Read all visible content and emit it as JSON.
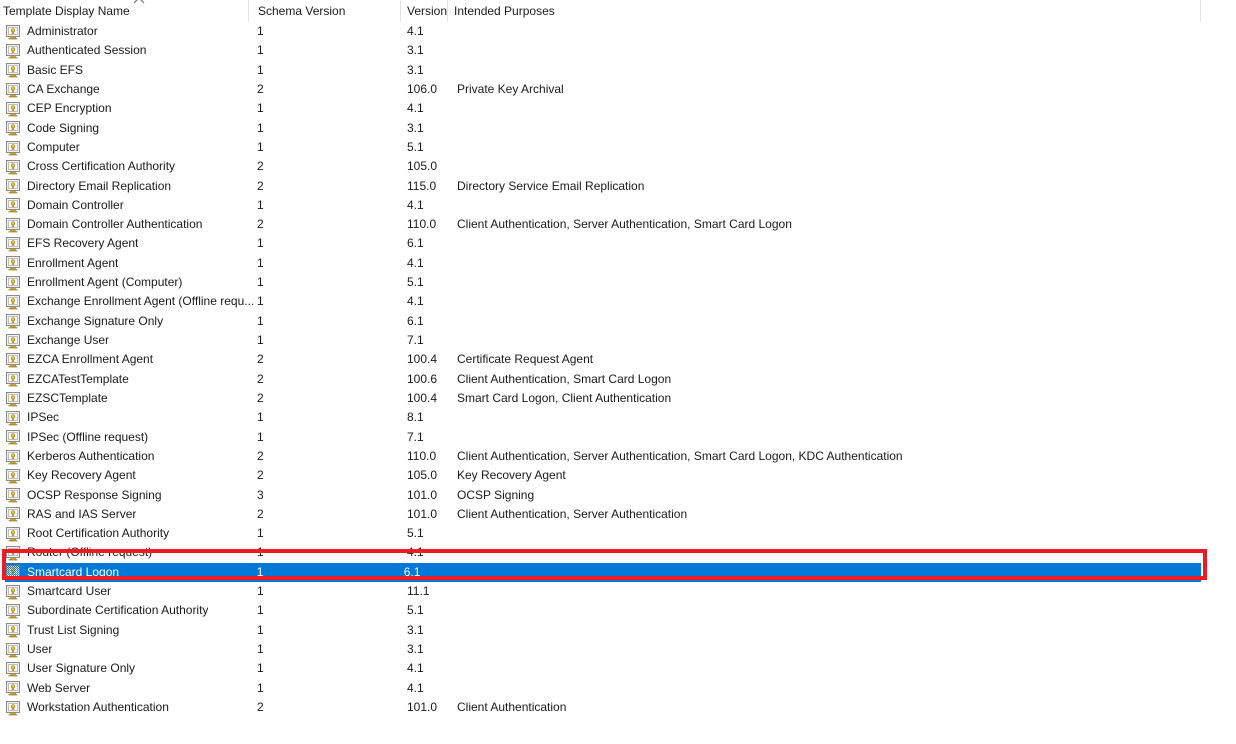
{
  "list": {
    "columns": [
      {
        "key": "name",
        "label": "Template Display Name",
        "sort": "ascending"
      },
      {
        "key": "schema",
        "label": "Schema Version"
      },
      {
        "key": "version",
        "label": "Version"
      },
      {
        "key": "purpose",
        "label": "Intended Purposes"
      }
    ],
    "icon": "certificate-template-icon",
    "selection_color": "#0078d7",
    "annotation_color": "#ed1c24",
    "selected_row_index": 28,
    "rows": [
      {
        "name": "Administrator",
        "schema": "1",
        "version": "4.1",
        "purpose": ""
      },
      {
        "name": "Authenticated Session",
        "schema": "1",
        "version": "3.1",
        "purpose": ""
      },
      {
        "name": "Basic EFS",
        "schema": "1",
        "version": "3.1",
        "purpose": ""
      },
      {
        "name": "CA Exchange",
        "schema": "2",
        "version": "106.0",
        "purpose": "Private Key Archival"
      },
      {
        "name": "CEP Encryption",
        "schema": "1",
        "version": "4.1",
        "purpose": ""
      },
      {
        "name": "Code Signing",
        "schema": "1",
        "version": "3.1",
        "purpose": ""
      },
      {
        "name": "Computer",
        "schema": "1",
        "version": "5.1",
        "purpose": ""
      },
      {
        "name": "Cross Certification Authority",
        "schema": "2",
        "version": "105.0",
        "purpose": ""
      },
      {
        "name": "Directory Email Replication",
        "schema": "2",
        "version": "115.0",
        "purpose": "Directory Service Email Replication"
      },
      {
        "name": "Domain Controller",
        "schema": "1",
        "version": "4.1",
        "purpose": ""
      },
      {
        "name": "Domain Controller Authentication",
        "schema": "2",
        "version": "110.0",
        "purpose": "Client Authentication, Server Authentication, Smart Card Logon"
      },
      {
        "name": "EFS Recovery Agent",
        "schema": "1",
        "version": "6.1",
        "purpose": ""
      },
      {
        "name": "Enrollment Agent",
        "schema": "1",
        "version": "4.1",
        "purpose": ""
      },
      {
        "name": "Enrollment Agent (Computer)",
        "schema": "1",
        "version": "5.1",
        "purpose": ""
      },
      {
        "name": "Exchange Enrollment Agent (Offline requ...",
        "schema": "1",
        "version": "4.1",
        "purpose": ""
      },
      {
        "name": "Exchange Signature Only",
        "schema": "1",
        "version": "6.1",
        "purpose": ""
      },
      {
        "name": "Exchange User",
        "schema": "1",
        "version": "7.1",
        "purpose": ""
      },
      {
        "name": "EZCA Enrollment Agent",
        "schema": "2",
        "version": "100.4",
        "purpose": "Certificate Request Agent"
      },
      {
        "name": "EZCATestTemplate",
        "schema": "2",
        "version": "100.6",
        "purpose": "Client Authentication, Smart Card Logon"
      },
      {
        "name": "EZSCTemplate",
        "schema": "2",
        "version": "100.4",
        "purpose": "Smart Card Logon, Client Authentication"
      },
      {
        "name": "IPSec",
        "schema": "1",
        "version": "8.1",
        "purpose": ""
      },
      {
        "name": "IPSec (Offline request)",
        "schema": "1",
        "version": "7.1",
        "purpose": ""
      },
      {
        "name": "Kerberos Authentication",
        "schema": "2",
        "version": "110.0",
        "purpose": "Client Authentication, Server Authentication, Smart Card Logon, KDC Authentication"
      },
      {
        "name": "Key Recovery Agent",
        "schema": "2",
        "version": "105.0",
        "purpose": "Key Recovery Agent"
      },
      {
        "name": "OCSP Response Signing",
        "schema": "3",
        "version": "101.0",
        "purpose": "OCSP Signing"
      },
      {
        "name": "RAS and IAS Server",
        "schema": "2",
        "version": "101.0",
        "purpose": "Client Authentication, Server Authentication"
      },
      {
        "name": "Root Certification Authority",
        "schema": "1",
        "version": "5.1",
        "purpose": ""
      },
      {
        "name": "Router (Offline request)",
        "schema": "1",
        "version": "4.1",
        "purpose": ""
      },
      {
        "name": "Smartcard Logon",
        "schema": "1",
        "version": "6.1",
        "purpose": ""
      },
      {
        "name": "Smartcard User",
        "schema": "1",
        "version": "11.1",
        "purpose": ""
      },
      {
        "name": "Subordinate Certification Authority",
        "schema": "1",
        "version": "5.1",
        "purpose": ""
      },
      {
        "name": "Trust List Signing",
        "schema": "1",
        "version": "3.1",
        "purpose": ""
      },
      {
        "name": "User",
        "schema": "1",
        "version": "3.1",
        "purpose": ""
      },
      {
        "name": "User Signature Only",
        "schema": "1",
        "version": "4.1",
        "purpose": ""
      },
      {
        "name": "Web Server",
        "schema": "1",
        "version": "4.1",
        "purpose": ""
      },
      {
        "name": "Workstation Authentication",
        "schema": "2",
        "version": "101.0",
        "purpose": "Client Authentication"
      }
    ]
  }
}
